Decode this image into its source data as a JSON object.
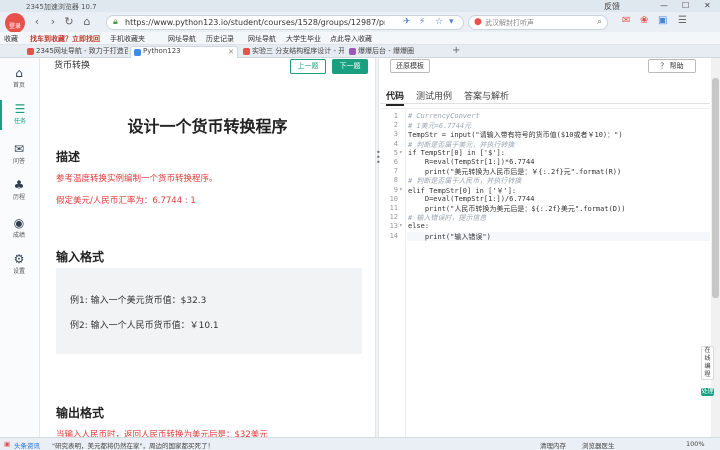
{
  "browser": {
    "title": "2345加速浏览器 10.7",
    "login_label": "登录",
    "window_controls": {
      "feedback": "反馈",
      "minimize": "—",
      "maximize": "☐",
      "close": "✕"
    },
    "url": "https://www.python123.io/student/courses/1528/groups/12987/problems/programming",
    "search_placeholder": "武汉解封打听声",
    "bookmarks": [
      "收藏",
      "找车到收藏？立即找回",
      "手机收藏夹",
      "网址导航",
      "历史记录",
      "网址导航",
      "大学生毕业",
      "点此导入收藏"
    ],
    "tabs": [
      {
        "label": "2345网址导航 - 致力于打造百",
        "active": false
      },
      {
        "label": "Python123",
        "active": true
      },
      {
        "label": "实验三 分支结构程序设计 - 开",
        "active": false
      },
      {
        "label": "爆爆后台 - 爆爆圈",
        "active": false
      }
    ],
    "new_tab": "+"
  },
  "sidebar": {
    "items": [
      {
        "icon": "home-icon",
        "glyph": "⌂",
        "label": "首页",
        "active": false
      },
      {
        "icon": "task-icon",
        "glyph": "☰",
        "label": "任务",
        "active": true
      },
      {
        "icon": "discussion-icon",
        "glyph": "✉",
        "label": "问答",
        "active": false
      },
      {
        "icon": "tree-icon",
        "glyph": "♣",
        "label": "历程",
        "active": false
      },
      {
        "icon": "score-icon",
        "glyph": "◉",
        "label": "成绩",
        "active": false
      },
      {
        "icon": "settings-icon",
        "glyph": "⚙",
        "label": "设置",
        "active": false
      }
    ]
  },
  "problem": {
    "header": "货币转换",
    "prev_label": "上一题",
    "next_label": "下一题",
    "title": "设计一个货币转换程序",
    "description_heading": "描述",
    "description_line1": "参考温度转换实例编制一个货币转换程序。",
    "description_line2": "假定美元/人民币汇率为：6.7744 : 1",
    "input_heading": "输入格式",
    "input_example1": "例1: 输入一个美元货币值：$32.3",
    "input_example2": "例2: 输入一个人民币货币值：￥10.1",
    "output_heading": "输出格式",
    "output_line": "当输入人民币时，返回人民币转换为美元后是：$32美元"
  },
  "editor": {
    "reset_label": "还原模板",
    "help_label": "？ 帮助",
    "tabs": [
      {
        "label": "代码",
        "active": true
      },
      {
        "label": "测试用例",
        "active": false
      },
      {
        "label": "答案与解析",
        "active": false
      }
    ],
    "lines": [
      "# CurrencyConvert",
      "# 1美元=6.7744元",
      "TempStr = input(\"请输入带有符号的货币值($10或者￥10)：\")",
      "# 判断是否属于美元，并执行转换",
      "if TempStr[0] in ['$']:",
      "    R=eval(TempStr[1:])*6.7744",
      "    print(\"美元转换为人民币后是：￥{:.2f}元\".format(R))",
      "# 判断是否属于人民币，并执行转换",
      "elif TempStr[0] in ['￥']:",
      "    D=eval(TempStr[1:])/6.7744",
      "    print(\"人民币转换为美元后是：${:.2f}美元\".format(D))",
      "# 输入错误时，提示信息",
      "else:",
      "    print(\"输入错误\")"
    ],
    "side_tabs": [
      "在线编程",
      "处理"
    ]
  },
  "statusbar": {
    "left_label": "头条资讯",
    "news": "\"研究表明，美元都将仍然在家\"，周边的国家都买死了！",
    "items": [
      "清理内存",
      "浏览器医生",
      "100%"
    ]
  }
}
